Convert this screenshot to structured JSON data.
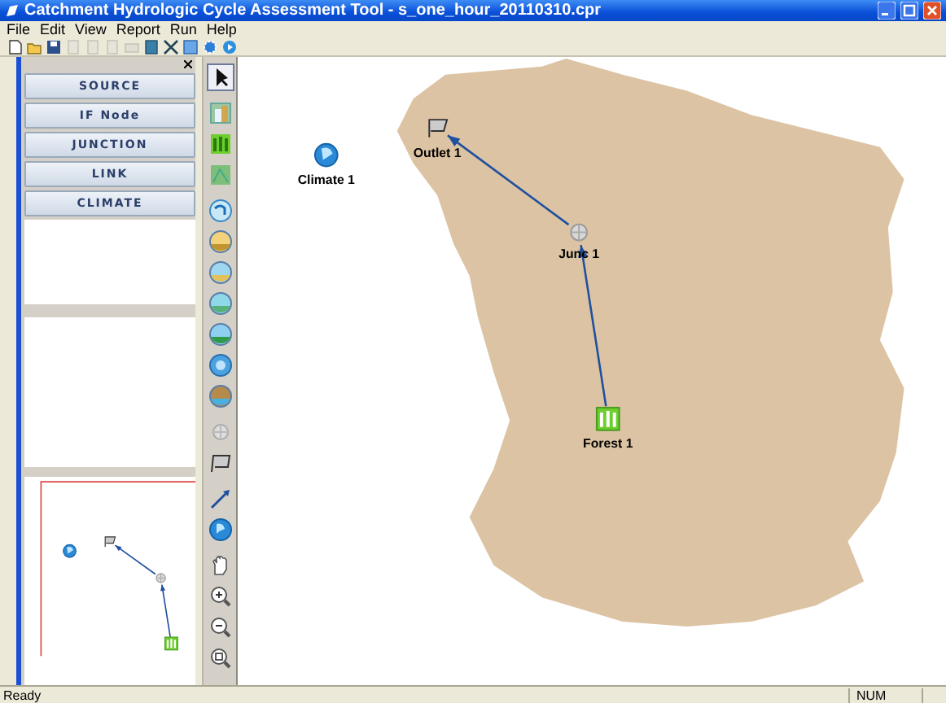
{
  "window": {
    "title": "Catchment Hydrologic Cycle Assessment Tool - s_one_hour_20110310.cpr"
  },
  "menu": [
    {
      "label": "File"
    },
    {
      "label": "Edit"
    },
    {
      "label": "View"
    },
    {
      "label": "Report"
    },
    {
      "label": "Run"
    },
    {
      "label": "Help"
    }
  ],
  "toolbar": [
    {
      "kind": "new",
      "disabled": false
    },
    {
      "kind": "open",
      "disabled": false
    },
    {
      "kind": "save",
      "disabled": false
    },
    {
      "kind": "doc",
      "disabled": true
    },
    {
      "kind": "doc",
      "disabled": true
    },
    {
      "kind": "doc",
      "disabled": true
    },
    {
      "kind": "print",
      "disabled": true
    },
    {
      "kind": "book",
      "disabled": false
    },
    {
      "kind": "fit",
      "disabled": false
    },
    {
      "kind": "grid",
      "disabled": false
    },
    {
      "kind": "gear",
      "disabled": false
    },
    {
      "kind": "play",
      "disabled": false
    }
  ],
  "element_buttons": [
    {
      "label": "SOURCE"
    },
    {
      "label": "IF Node"
    },
    {
      "label": "JUNCTION"
    },
    {
      "label": "LINK"
    },
    {
      "label": "CLIMATE"
    }
  ],
  "palette": [
    {
      "kind": "pointer",
      "selected": true
    },
    {
      "kind": "urban",
      "selected": false
    },
    {
      "kind": "forest",
      "selected": false
    },
    {
      "kind": "field",
      "selected": false
    },
    {
      "kind": "reuse",
      "selected": false
    },
    {
      "kind": "tank",
      "selected": false
    },
    {
      "kind": "wetland",
      "selected": false
    },
    {
      "kind": "pond",
      "selected": false
    },
    {
      "kind": "river",
      "selected": false
    },
    {
      "kind": "globe",
      "selected": false
    },
    {
      "kind": "soil",
      "selected": false
    },
    {
      "kind": "junction",
      "selected": false
    },
    {
      "kind": "outlet",
      "selected": false
    },
    {
      "kind": "link",
      "selected": false
    },
    {
      "kind": "climate",
      "selected": false
    },
    {
      "kind": "hand",
      "selected": false
    },
    {
      "kind": "zoom-in",
      "selected": false
    },
    {
      "kind": "zoom-out",
      "selected": false
    },
    {
      "kind": "zoom-fit",
      "selected": false
    }
  ],
  "nodes": [
    {
      "kind": "climate",
      "label": "Climate 1"
    },
    {
      "kind": "outlet",
      "label": "Outlet 1"
    },
    {
      "kind": "junction",
      "label": "Junc 1"
    },
    {
      "kind": "forest",
      "label": "Forest 1"
    }
  ],
  "status_bar": {
    "message": "Ready",
    "indicator": "NUM"
  }
}
